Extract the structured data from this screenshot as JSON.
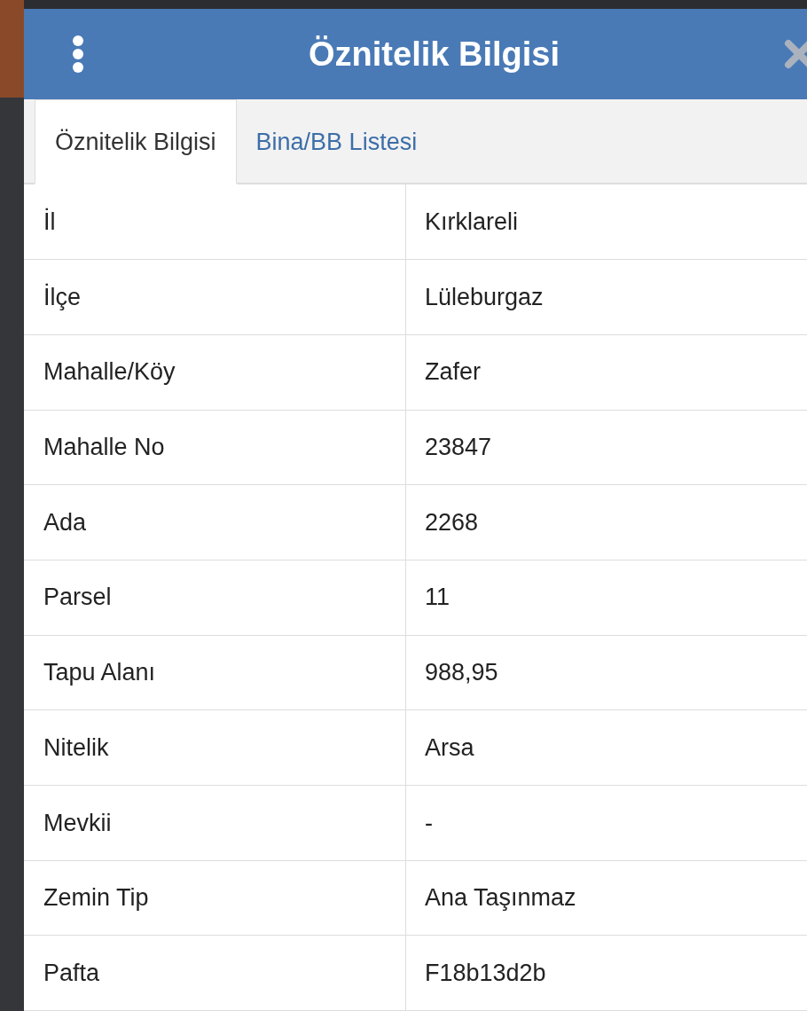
{
  "dialog": {
    "title": "Öznitelik Bilgisi"
  },
  "tabs": [
    {
      "label": "Öznitelik Bilgisi",
      "selected": true
    },
    {
      "label": "Bina/BB Listesi",
      "selected": false
    }
  ],
  "table": {
    "rows": [
      {
        "label": "İl",
        "value": "Kırklareli"
      },
      {
        "label": "İlçe",
        "value": "Lüleburgaz"
      },
      {
        "label": "Mahalle/Köy",
        "value": "Zafer"
      },
      {
        "label": "Mahalle No",
        "value": "23847"
      },
      {
        "label": "Ada",
        "value": "2268"
      },
      {
        "label": "Parsel",
        "value": "11"
      },
      {
        "label": "Tapu Alanı",
        "value": "988,95"
      },
      {
        "label": "Nitelik",
        "value": "Arsa"
      },
      {
        "label": "Mevkii",
        "value": "-"
      },
      {
        "label": "Zemin Tip",
        "value": "Ana Taşınmaz"
      },
      {
        "label": "Pafta",
        "value": "F18b13d2b"
      }
    ]
  }
}
